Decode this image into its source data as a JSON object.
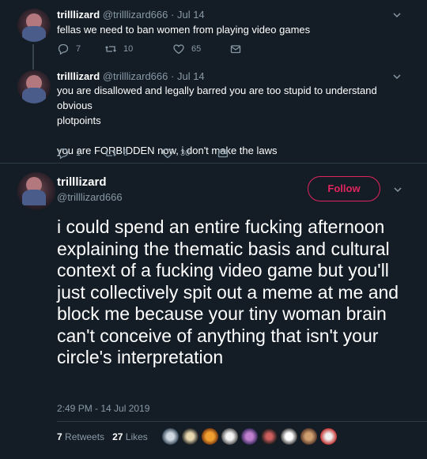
{
  "tweets": [
    {
      "name": "trilllizard",
      "handle": "@trilllizard666",
      "date": "Jul 14",
      "text": "fellas we need to ban women from playing video games",
      "replies": "7",
      "retweets": "10",
      "likes": "65"
    },
    {
      "name": "trilllizard",
      "handle": "@trilllizard666",
      "date": "Jul 14",
      "text_line1": "you are disallowed and legally barred you are too stupid to understand obvious",
      "text_line2": "plotpoints",
      "text_line3": "you are FORBIDDEN now, i don't make the laws",
      "replies": "1",
      "retweets": "5",
      "likes": "30"
    }
  ],
  "focused": {
    "name": "trilllizard",
    "handle": "@trilllizard666",
    "follow_label": "Follow",
    "text": "i could spend an entire fucking afternoon explaining the thematic basis and cultural context of a fucking video game but you'll just collectively spit out a meme at me and block me because your tiny woman brain can't conceive of anything that isn't your circle's interpretation",
    "timestamp": "2:49 PM - 14 Jul 2019",
    "retweets_count": "7",
    "retweets_label": "Retweets",
    "likes_count": "27",
    "likes_label": "Likes"
  },
  "colors": {
    "background": "#141d26",
    "secondary_text": "#8899a6",
    "follow_accent": "#e0245e"
  },
  "icons": [
    "reply-icon",
    "retweet-icon",
    "like-icon",
    "dm-icon",
    "chevron-down-icon"
  ]
}
